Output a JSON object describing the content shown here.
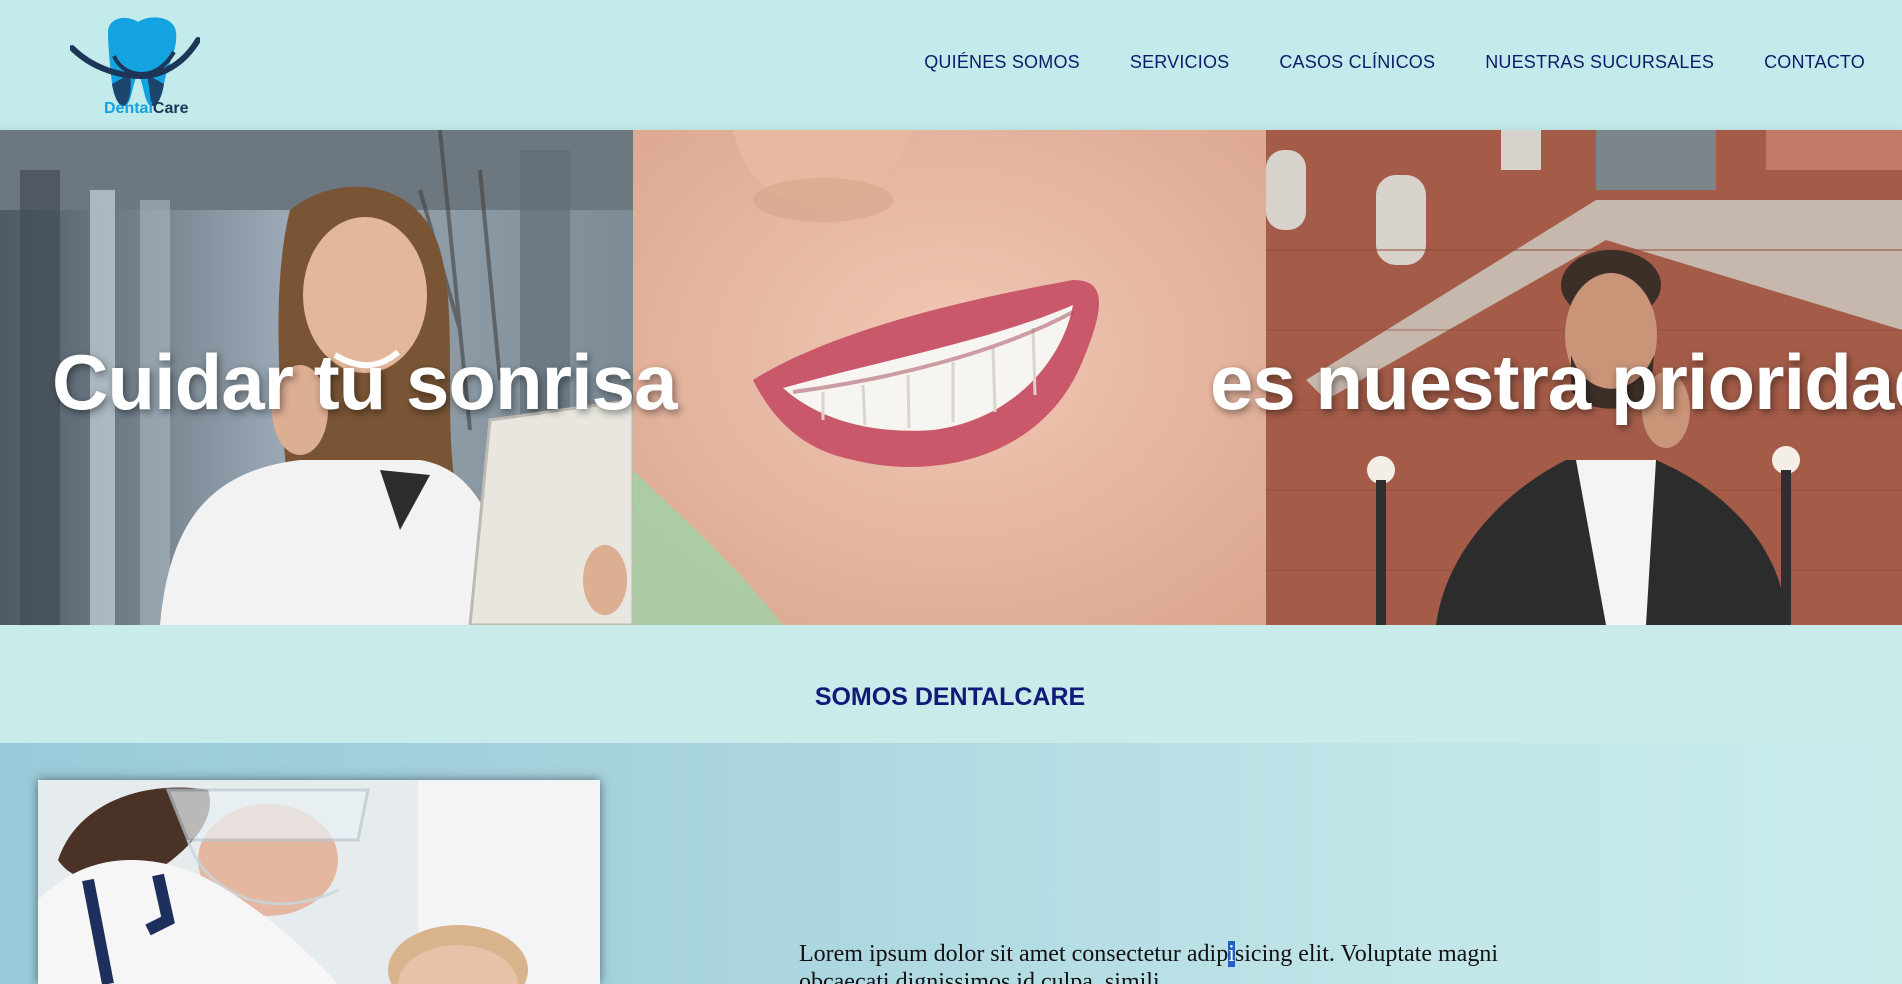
{
  "header": {
    "logo_word_1": "Dental",
    "logo_word_2": "Care",
    "nav": [
      {
        "label": "QUIÉNES SOMOS"
      },
      {
        "label": "SERVICIOS"
      },
      {
        "label": "CASOS CLÍNICOS"
      },
      {
        "label": "NUESTRAS SUCURSALES"
      },
      {
        "label": "CONTACTO"
      }
    ]
  },
  "hero": {
    "left_text": "Cuidar tu sonrisa",
    "right_text": "es nuestra prioridad"
  },
  "about": {
    "title": "SOMOS DENTALCARE",
    "text_before": "Lorem ipsum dolor sit amet consectetur adip",
    "text_highlight": "i",
    "text_after": "sicing elit. Voluptate magni obcaecati dignissimos id culpa, simili"
  },
  "colors": {
    "header_bg": "#c3ebeb",
    "nav_text": "#101a6b",
    "logo_blue": "#12a3e0",
    "logo_dark": "#1d3557",
    "title_blue": "#111a78"
  }
}
